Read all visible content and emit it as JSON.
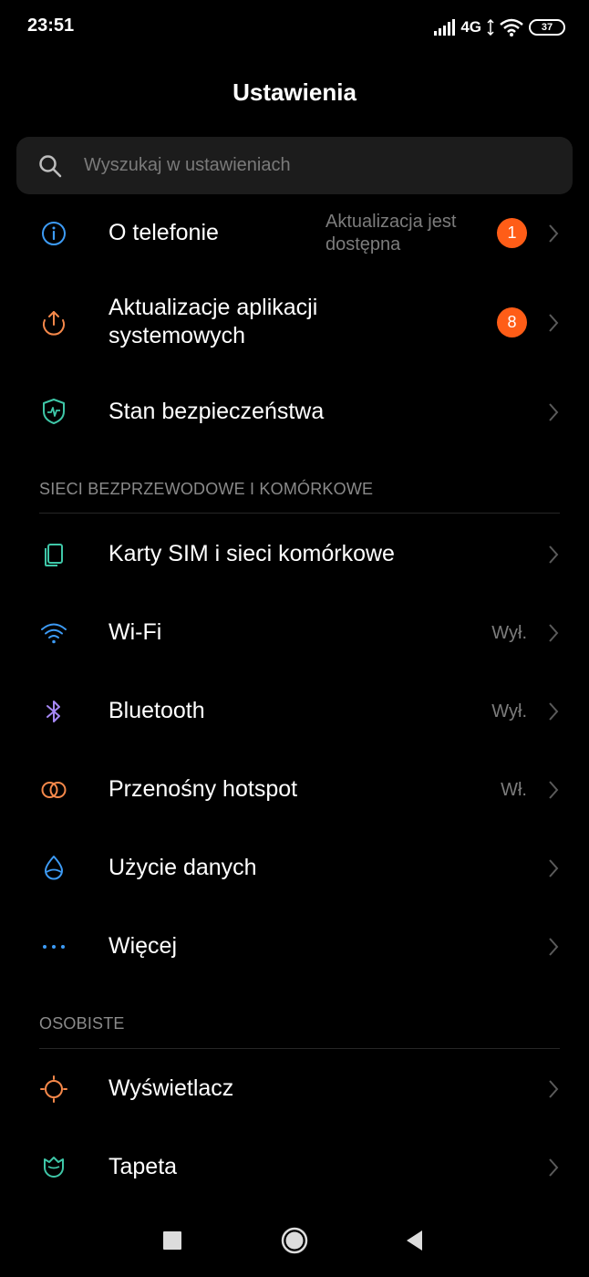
{
  "status_bar": {
    "time": "23:51",
    "network": "4G",
    "battery": "37"
  },
  "header": {
    "title": "Ustawienia"
  },
  "search": {
    "placeholder": "Wyszukaj w ustawieniach"
  },
  "top_items": [
    {
      "label": "O telefonie",
      "value": "Aktualizacja jest dostępna",
      "badge": "1",
      "icon": "info-icon",
      "icon_color": "#3d9bf5"
    },
    {
      "label": "Aktualizacje aplikacji systemowych",
      "badge": "8",
      "icon": "update-arrow-icon",
      "icon_color": "#f5884a"
    },
    {
      "label": "Stan bezpieczeństwa",
      "icon": "shield-icon",
      "icon_color": "#3fc7a8"
    }
  ],
  "sections": [
    {
      "title": "SIECI BEZPRZEWODOWE I KOMÓRKOWE",
      "items": [
        {
          "label": "Karty SIM i sieci komórkowe",
          "icon": "sim-card-icon",
          "icon_color": "#3fc7a8"
        },
        {
          "label": "Wi-Fi",
          "value": "Wył.",
          "icon": "wifi-icon",
          "icon_color": "#3d9bf5"
        },
        {
          "label": "Bluetooth",
          "value": "Wył.",
          "icon": "bluetooth-icon",
          "icon_color": "#a688f5"
        },
        {
          "label": "Przenośny hotspot",
          "value": "Wł.",
          "icon": "hotspot-icon",
          "icon_color": "#f5884a"
        },
        {
          "label": "Użycie danych",
          "icon": "data-drop-icon",
          "icon_color": "#3d9bf5"
        },
        {
          "label": "Więcej",
          "icon": "more-dots-icon",
          "icon_color": "#3d9bf5"
        }
      ]
    },
    {
      "title": "OSOBISTE",
      "items": [
        {
          "label": "Wyświetlacz",
          "icon": "display-sun-icon",
          "icon_color": "#f5884a"
        },
        {
          "label": "Tapeta",
          "icon": "wallpaper-tulip-icon",
          "icon_color": "#3fc7a8"
        }
      ]
    }
  ],
  "colors": {
    "background": "#000000",
    "accent_badge": "#ff5d17",
    "secondary_text": "#7c7c7c"
  }
}
